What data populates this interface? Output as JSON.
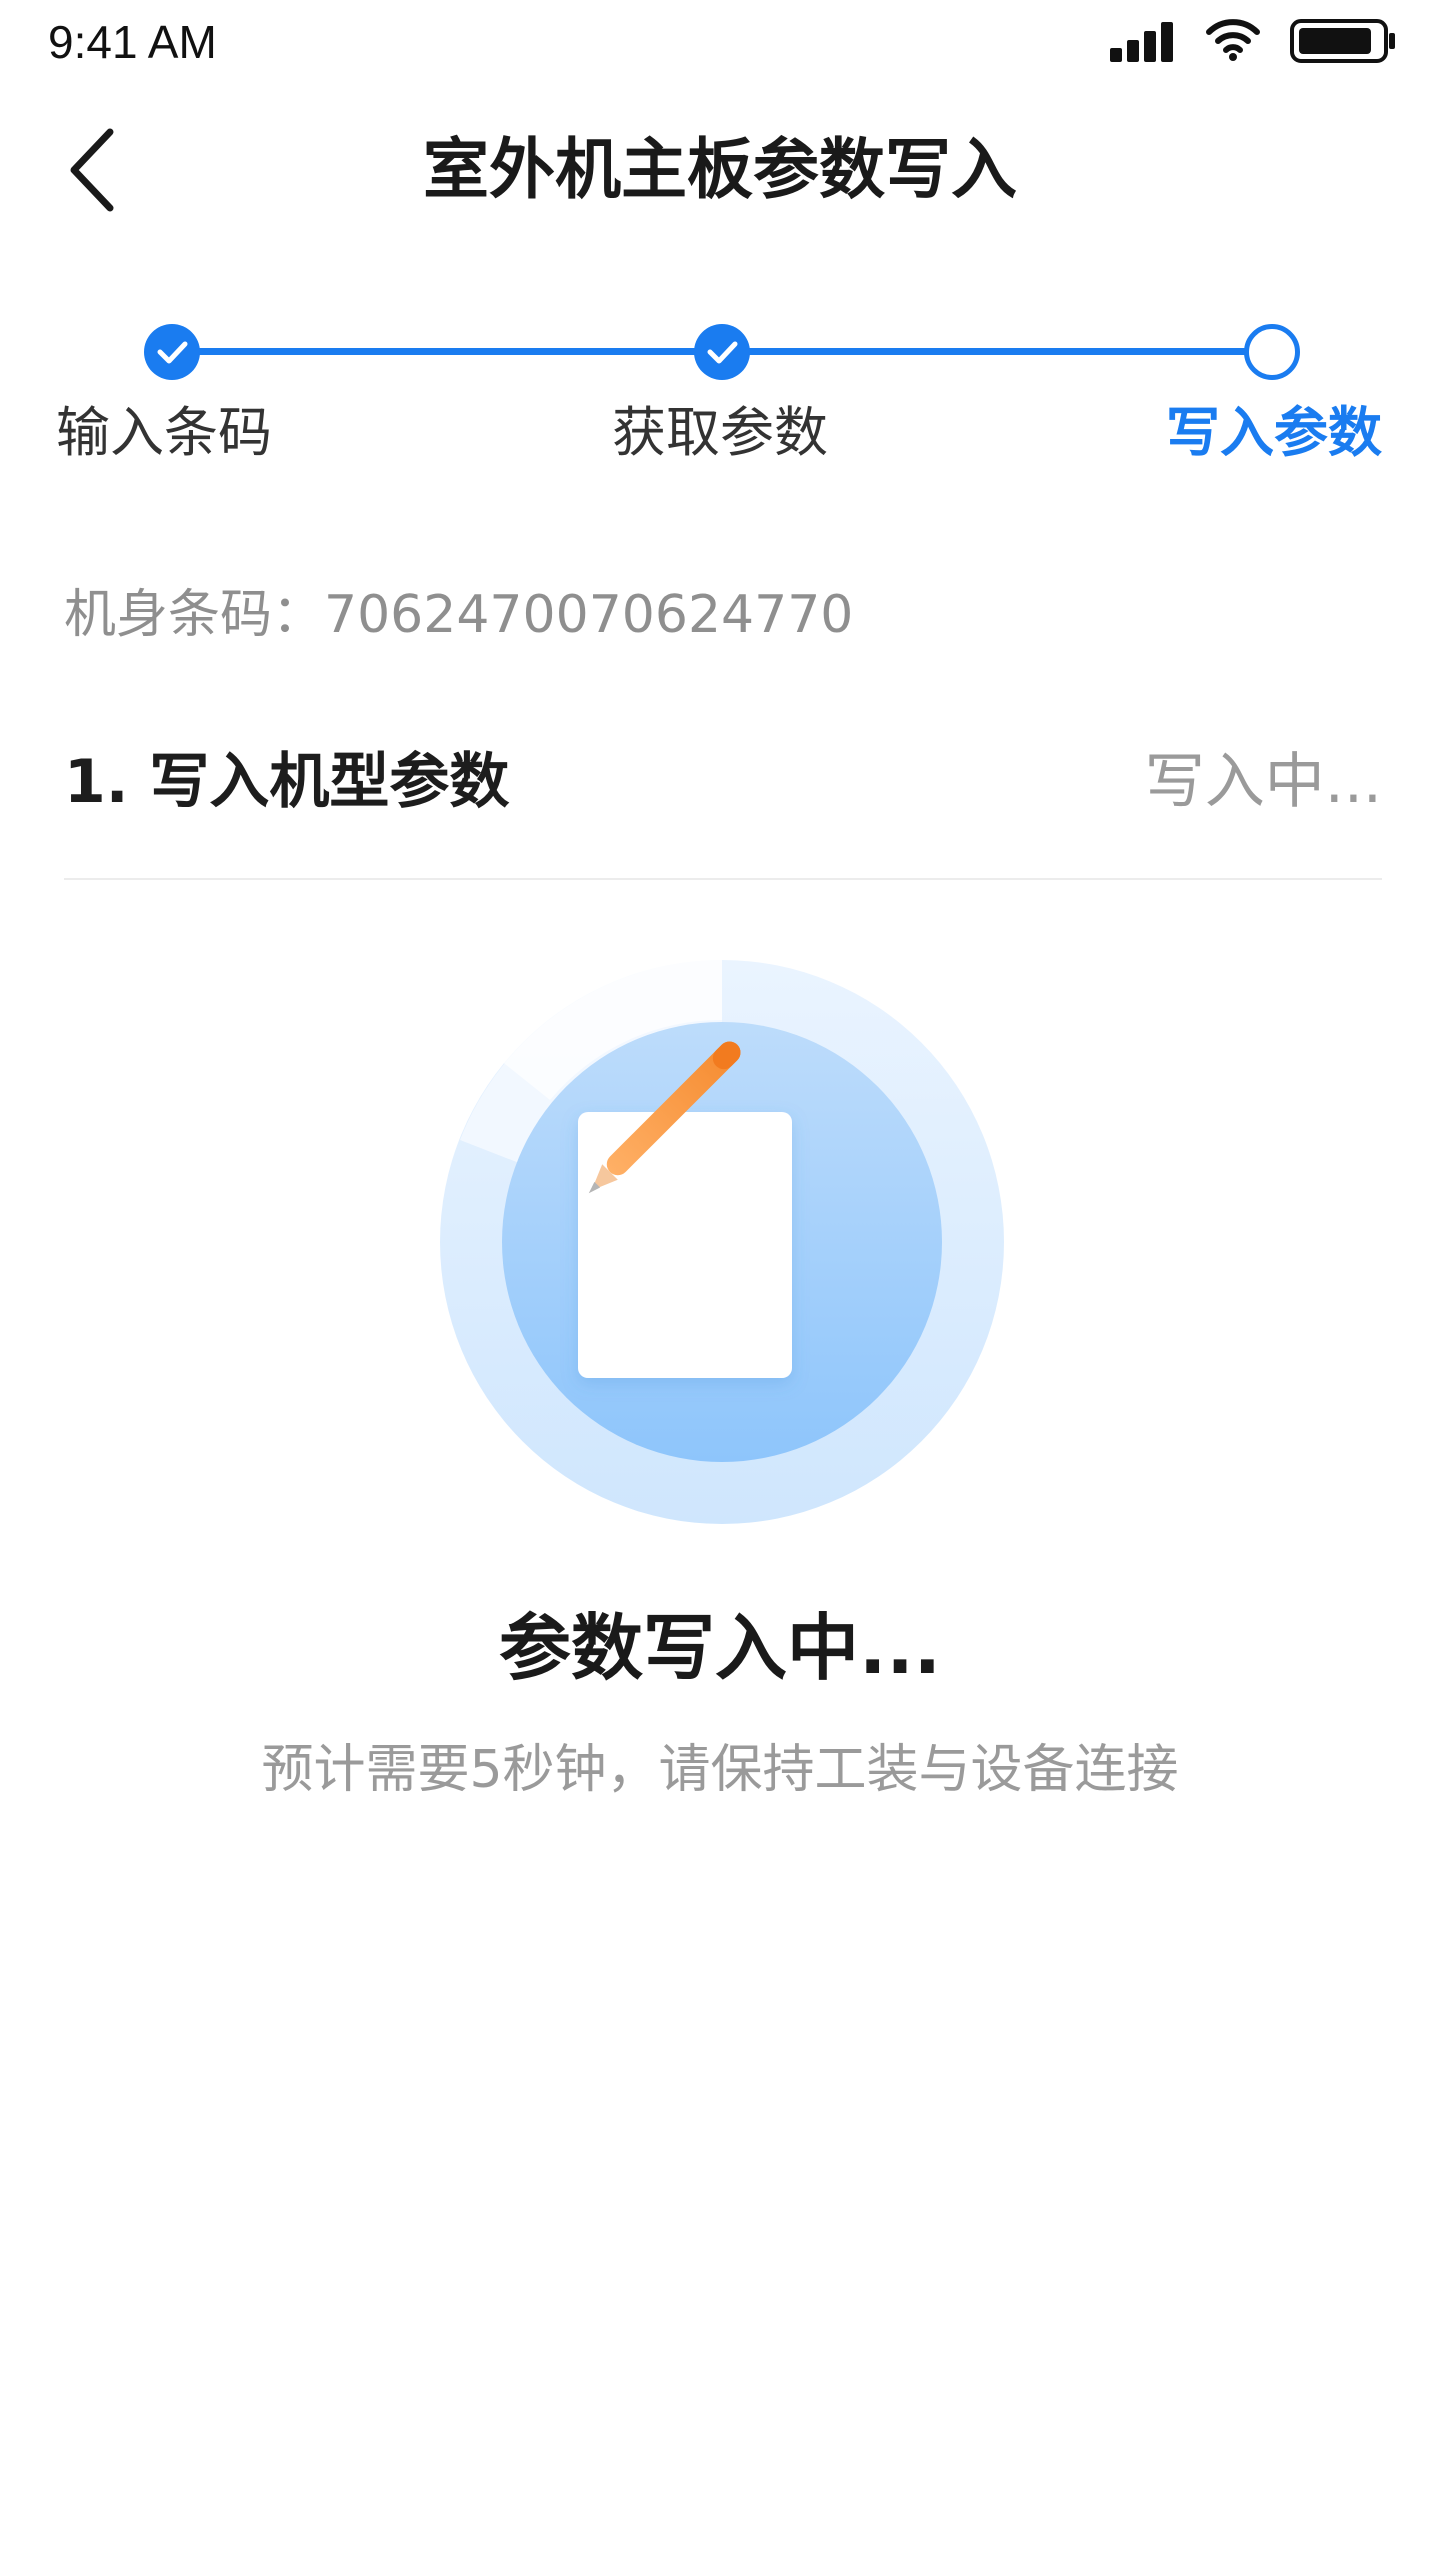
{
  "status_bar": {
    "time": "9:41 AM",
    "icons": [
      "signal-icon",
      "wifi-icon",
      "battery-icon"
    ]
  },
  "nav": {
    "back_icon": "chevron-left-icon",
    "title": "室外机主板参数写入"
  },
  "stepper": {
    "steps": [
      {
        "label": "输入条码",
        "state": "done"
      },
      {
        "label": "获取参数",
        "state": "done"
      },
      {
        "label": "写入参数",
        "state": "current"
      }
    ]
  },
  "barcode": {
    "label": "机身条码：",
    "value": "7062470070624770"
  },
  "task": {
    "title": "1. 写入机型参数",
    "status": "写入中..."
  },
  "progress": {
    "icon": "document-pen-icon",
    "title": "参数写入中...",
    "hint": "预计需要5秒钟，请保持工装与设备连接"
  },
  "colors": {
    "accent": "#1a7cf0",
    "muted_text": "#9a9a9a",
    "title_text": "#1a1a1a"
  }
}
